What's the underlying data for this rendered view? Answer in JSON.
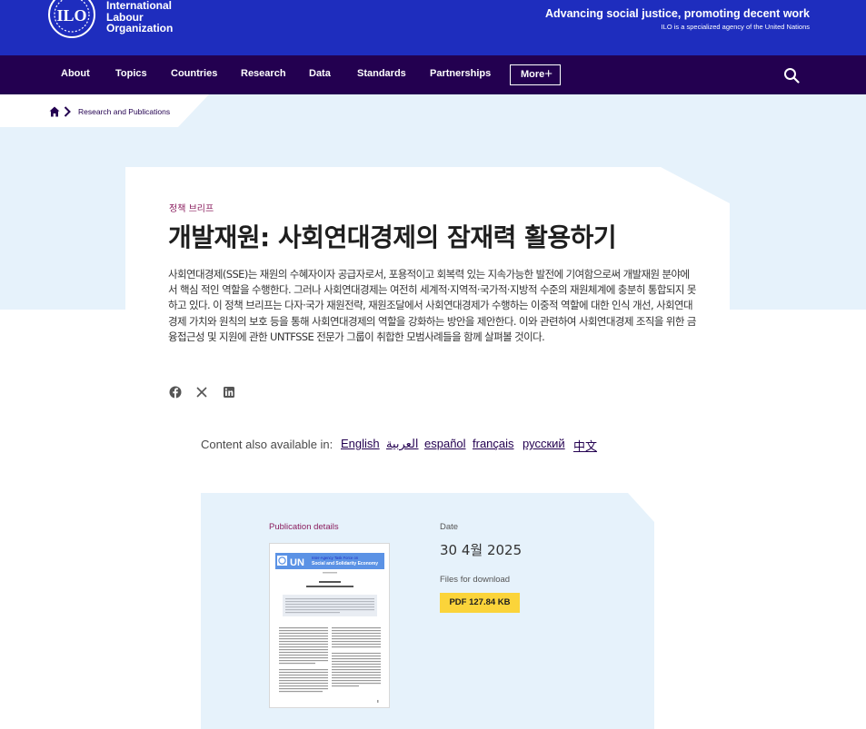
{
  "header": {
    "org_name": [
      "International",
      "Labour",
      "Organization"
    ],
    "logo_text": "ILO",
    "tagline": "Advancing social justice, promoting decent work",
    "subtagline": "ILO is a specialized agency of the United Nations",
    "colors": {
      "brand_blue": "#1e2dbe",
      "nav_purple": "#230050",
      "light_band": "#e6f2fb",
      "accent_magenta": "#8a1d5e",
      "pdf_yellow": "#fbd43a"
    }
  },
  "nav": {
    "items": [
      "About",
      "Topics",
      "Countries",
      "Research",
      "Data",
      "Standards",
      "Partnerships"
    ],
    "more_label": "More",
    "more_icon": "plus-icon",
    "search_icon": "search-icon"
  },
  "breadcrumb": {
    "home_icon": "home-icon",
    "separator_icon": "chevron-right-icon",
    "link": "Research and Publications"
  },
  "article": {
    "eyebrow": "정책 브리프",
    "title": "개발재원: 사회연대경제의 잠재력 활용하기",
    "summary": "사회연대경제(SSE)는 재원의 수혜자이자 공급자로서, 포용적이고 회복력 있는 지속가능한 발전에 기여함으로써 개발재원 분야에서 핵심 적인 역할을 수행한다. 그러나 사회연대경제는 여전히 세계적·지역적·국가적·지방적 수준의 재원체계에 충분히 통합되지 못하고 있다. 이 정책 브리프는 다자·국가 재원전략, 재원조달에서 사회연대경제가 수행하는 이중적 역할에 대한 인식 개선, 사회연대경제 가치와 원칙의 보호 등을 통해 사회연대경제의 역할을 강화하는 방안을 제안한다. 이와 관련하여 사회연대경제 조직을 위한 금융접근성 및 지원에 관한 UNTFSSE 전문가 그룹이 취합한 모범사례들을 함께 살펴볼 것이다.",
    "share_icons": [
      "facebook-icon",
      "x-icon",
      "linkedin-icon"
    ]
  },
  "languages": {
    "label": "Content also available in:",
    "items": [
      "English",
      "العربية",
      "español",
      "français",
      "русский",
      "中文"
    ]
  },
  "publication": {
    "details_label": "Publication details",
    "date_label": "Date",
    "date_value": "30 4월 2025",
    "files_label": "Files for download",
    "pdf_button": "PDF 127.84 KB",
    "thumbnail": {
      "un_badge": "UN",
      "banner_line1": "Inter-Agency Task Force on",
      "banner_line2": "Social and Solidarity Economy"
    }
  }
}
